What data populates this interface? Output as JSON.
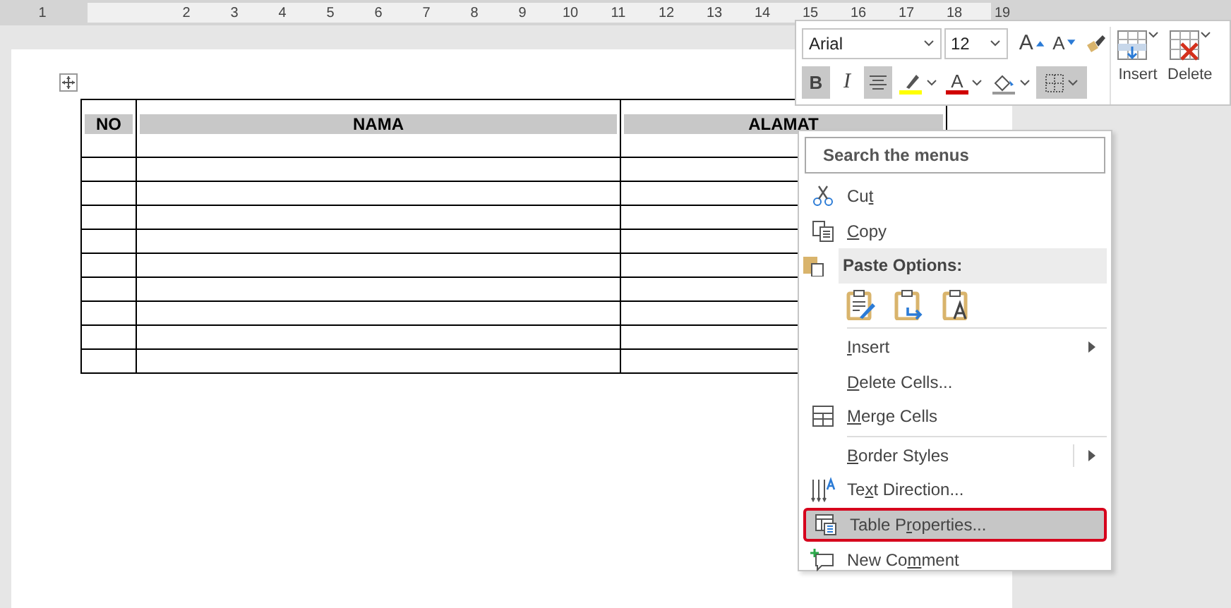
{
  "ruler": {
    "labels": [
      "1",
      "2",
      "3",
      "4",
      "5",
      "6",
      "7",
      "8",
      "9",
      "10",
      "11",
      "12",
      "13",
      "14",
      "15",
      "16",
      "17",
      "18",
      "19"
    ]
  },
  "table": {
    "columns": [
      {
        "label": "NO"
      },
      {
        "label": "NAMA"
      },
      {
        "label": "ALAMAT"
      }
    ],
    "rows": [
      {
        "kind": "blank"
      },
      {
        "kind": "blank"
      },
      {
        "kind": "blank"
      },
      {
        "kind": "blank"
      },
      {
        "kind": "blank"
      },
      {
        "kind": "blank"
      },
      {
        "kind": "blank"
      },
      {
        "kind": "blank"
      },
      {
        "kind": "blank"
      }
    ]
  },
  "mini_toolbar": {
    "font": {
      "value": "Arial"
    },
    "size": {
      "value": "12"
    },
    "row1": [
      {
        "kind": "grow",
        "label": "A"
      },
      {
        "kind": "shrink",
        "label": "A"
      },
      {
        "kind": "painter"
      }
    ],
    "row2": [
      {
        "kind": "bold",
        "label": "B",
        "selected": true
      },
      {
        "kind": "italic",
        "label": "I",
        "selected": false
      },
      {
        "kind": "align",
        "selected": true
      },
      {
        "kind": "highlight",
        "selected": false
      },
      {
        "kind": "fontcolor",
        "label": "A",
        "selected": false
      },
      {
        "kind": "shading",
        "selected": false
      },
      {
        "kind": "borders",
        "selected": true
      }
    ],
    "big_buttons": [
      {
        "kind": "insert",
        "label": "Insert"
      },
      {
        "kind": "delete",
        "label": "Delete"
      }
    ]
  },
  "context_menu": {
    "search": {
      "placeholder": "Search the menus"
    },
    "items": [
      {
        "kind": "item",
        "label": {
          "before": "Cu",
          "key": "t"
        },
        "has_submenu": false,
        "selected": false
      },
      {
        "kind": "item",
        "label": {
          "key": "C",
          "after": "opy"
        },
        "has_submenu": false,
        "selected": false
      },
      {
        "kind": "header",
        "label": "Paste Options:"
      },
      {
        "kind": "paste_row"
      },
      {
        "kind": "separator"
      },
      {
        "kind": "item",
        "label": {
          "key": "I",
          "after": "nsert"
        },
        "has_submenu": true,
        "selected": false
      },
      {
        "kind": "item",
        "label": {
          "key": "D",
          "after": "elete Cells..."
        },
        "has_submenu": false,
        "selected": false
      },
      {
        "kind": "item",
        "label": {
          "key": "M",
          "after": "erge Cells"
        },
        "has_submenu": false,
        "selected": false
      },
      {
        "kind": "separator"
      },
      {
        "kind": "item",
        "label": {
          "key": "B",
          "after": "order Styles"
        },
        "has_submenu": true,
        "selected": false
      },
      {
        "kind": "item",
        "label": {
          "before": "Te",
          "key": "x",
          "after": "t Direction..."
        },
        "has_submenu": false,
        "selected": false
      },
      {
        "kind": "item",
        "label": {
          "before": "Table P",
          "key": "r",
          "after": "operties..."
        },
        "has_submenu": false,
        "selected": true
      },
      {
        "kind": "item",
        "label": {
          "before": "New Co",
          "key": "m",
          "after": "ment"
        },
        "has_submenu": false,
        "selected": false
      }
    ]
  }
}
